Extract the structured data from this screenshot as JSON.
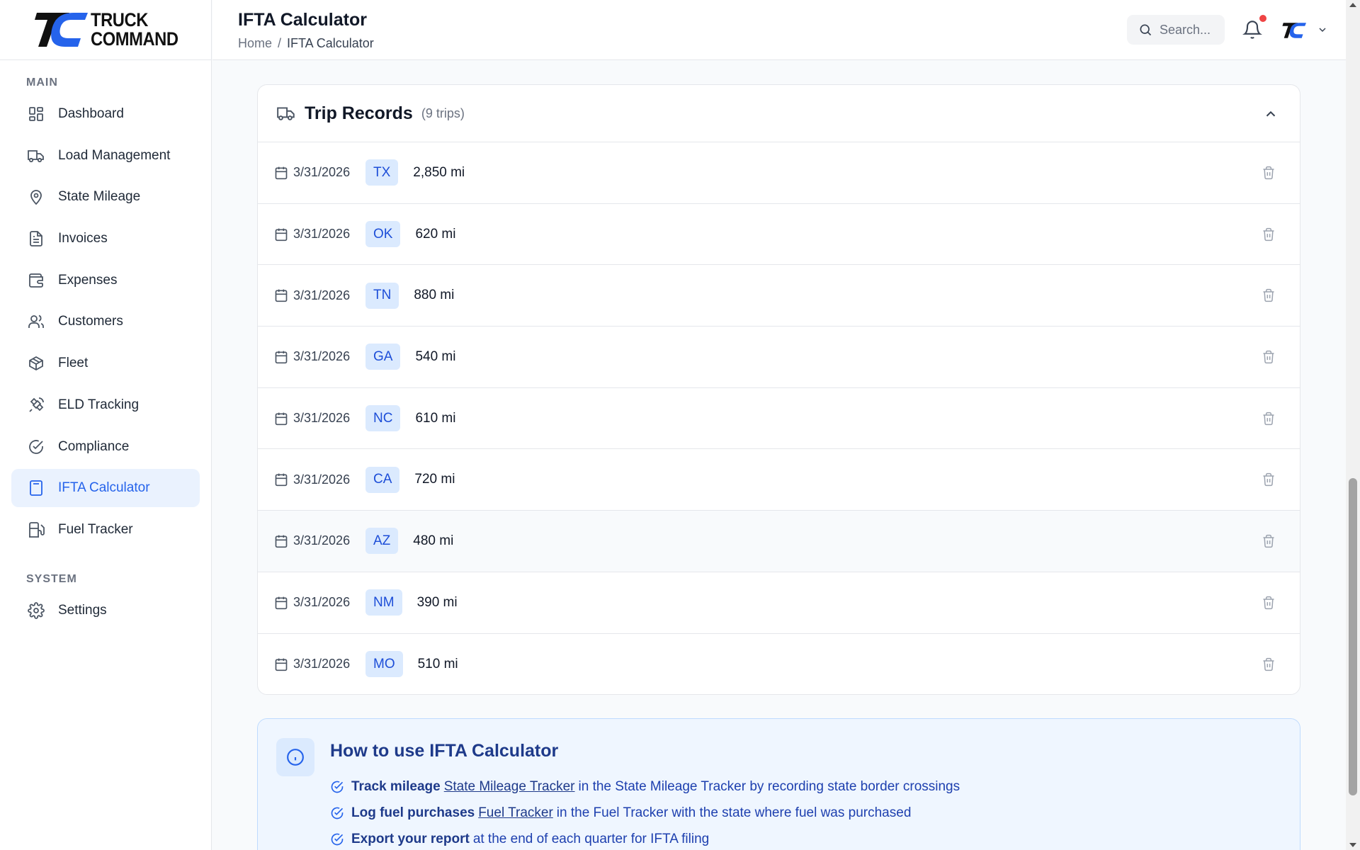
{
  "brand": {
    "line1": "TRUCK",
    "line2": "COMMAND"
  },
  "sidebar": {
    "main_label": "MAIN",
    "system_label": "SYSTEM",
    "items": [
      {
        "label": "Dashboard",
        "icon": "dashboard-icon"
      },
      {
        "label": "Load Management",
        "icon": "truck-icon"
      },
      {
        "label": "State Mileage",
        "icon": "map-pin-icon"
      },
      {
        "label": "Invoices",
        "icon": "document-icon"
      },
      {
        "label": "Expenses",
        "icon": "wallet-icon"
      },
      {
        "label": "Customers",
        "icon": "users-icon"
      },
      {
        "label": "Fleet",
        "icon": "box-icon"
      },
      {
        "label": "ELD Tracking",
        "icon": "satellite-icon"
      },
      {
        "label": "Compliance",
        "icon": "check-circle-icon"
      },
      {
        "label": "IFTA Calculator",
        "icon": "calculator-icon",
        "active": true
      },
      {
        "label": "Fuel Tracker",
        "icon": "fuel-icon"
      }
    ],
    "system_items": [
      {
        "label": "Settings",
        "icon": "gear-icon"
      }
    ]
  },
  "header": {
    "title": "IFTA Calculator",
    "breadcrumb": {
      "home": "Home",
      "separator": "/",
      "current": "IFTA Calculator"
    },
    "search_placeholder": "Search..."
  },
  "trip_records": {
    "title": "Trip Records",
    "count": "(9 trips)",
    "rows": [
      {
        "date": "3/31/2026",
        "state": "TX",
        "miles": "2,850 mi"
      },
      {
        "date": "3/31/2026",
        "state": "OK",
        "miles": "620 mi"
      },
      {
        "date": "3/31/2026",
        "state": "TN",
        "miles": "880 mi"
      },
      {
        "date": "3/31/2026",
        "state": "GA",
        "miles": "540 mi"
      },
      {
        "date": "3/31/2026",
        "state": "NC",
        "miles": "610 mi"
      },
      {
        "date": "3/31/2026",
        "state": "CA",
        "miles": "720 mi"
      },
      {
        "date": "3/31/2026",
        "state": "AZ",
        "miles": "480 mi"
      },
      {
        "date": "3/31/2026",
        "state": "NM",
        "miles": "390 mi"
      },
      {
        "date": "3/31/2026",
        "state": "MO",
        "miles": "510 mi"
      }
    ]
  },
  "how_to": {
    "title": "How to use IFTA Calculator",
    "steps": [
      {
        "bold": "Track mileage",
        "link": "State Mileage Tracker",
        "rest": "in the State Mileage Tracker by recording state border crossings"
      },
      {
        "bold": "Log fuel purchases",
        "link": "Fuel Tracker",
        "rest": "in the Fuel Tracker with the state where fuel was purchased"
      },
      {
        "bold": "Export your report",
        "link": "",
        "rest": "at the end of each quarter for IFTA filing"
      }
    ]
  },
  "colors": {
    "accent": "#2563eb",
    "badge_bg": "#dbeafe",
    "notification": "#ef4444"
  }
}
